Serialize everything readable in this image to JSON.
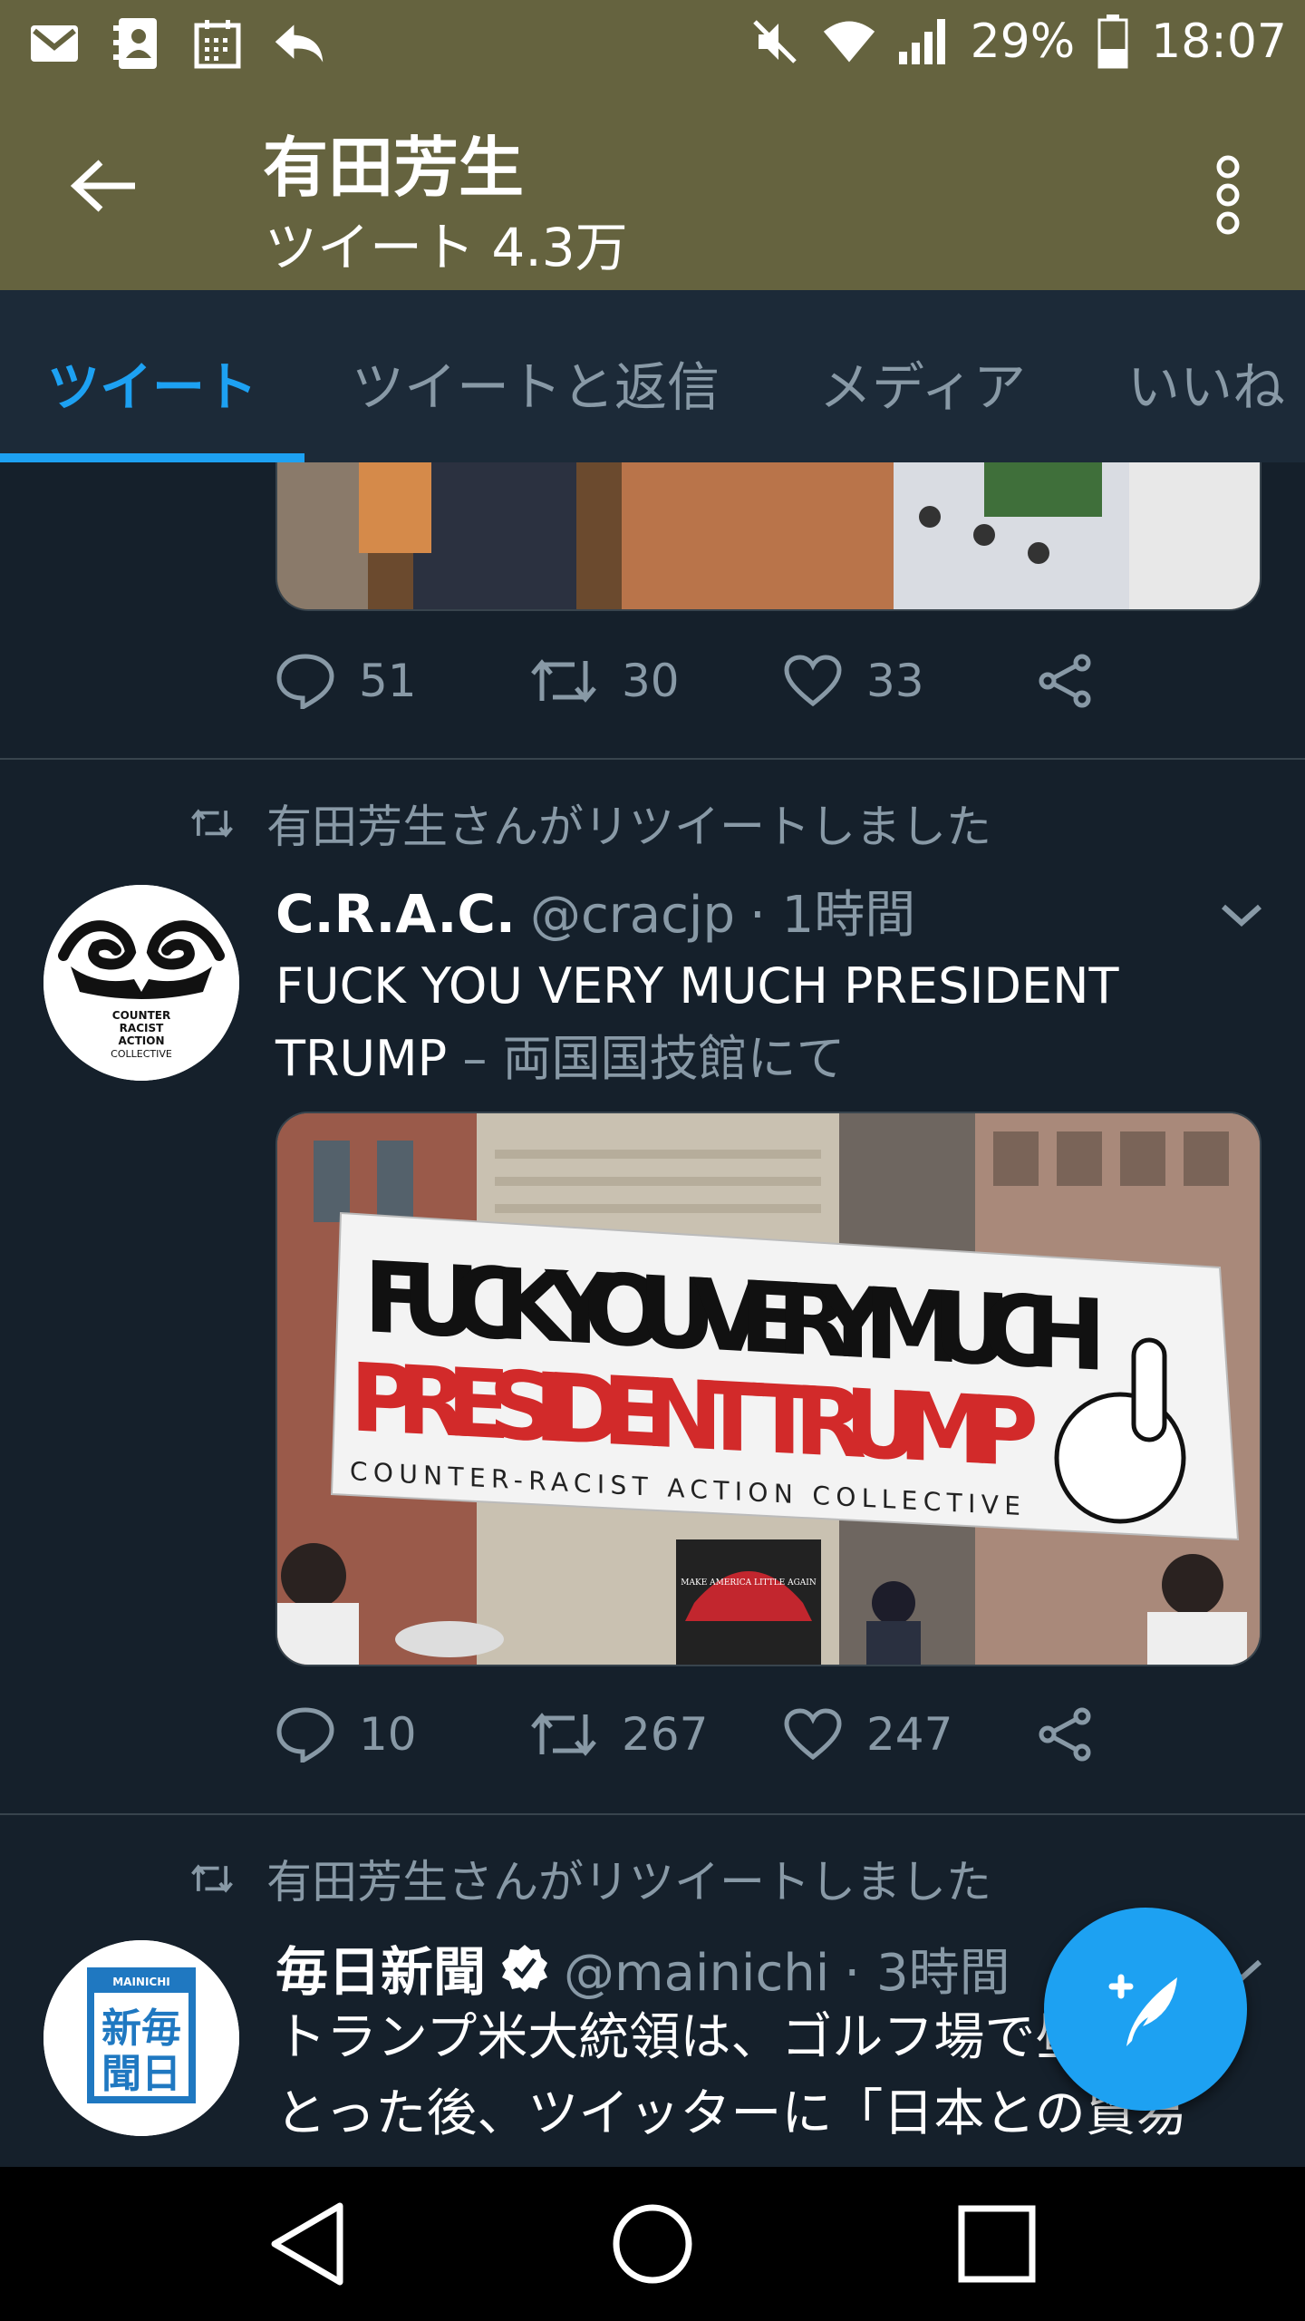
{
  "status_bar": {
    "left_icons": [
      "mail-icon",
      "contacts-icon",
      "calendar-icon",
      "reply-icon"
    ],
    "battery_percent": "29%",
    "time": "18:07",
    "right_icons": [
      "mute-icon",
      "wifi-icon",
      "signal-icon",
      "battery-icon"
    ]
  },
  "header": {
    "title": "有田芳生",
    "subtitle": "ツイート 4.3万",
    "background": "#65633f"
  },
  "tabs": [
    {
      "label": "ツイート",
      "active": true
    },
    {
      "label": "ツイートと返信",
      "active": false
    },
    {
      "label": "メディア",
      "active": false
    },
    {
      "label": "いいね",
      "active": false
    }
  ],
  "tweets": [
    {
      "partial": true,
      "actions": {
        "reply": "51",
        "retweet": "30",
        "like": "33"
      }
    },
    {
      "retweet_label": "有田芳生さんがリツイートしました",
      "name": "C.R.A.C.",
      "handle": "@cracjp",
      "time": "· 1時間",
      "text_line1": "FUCK YOU VERY MUCH PRESIDENT",
      "text_line2": "TRUMP",
      "location": "– 両国国技館にて",
      "avatar_logo_text": "COUNTER RACIST ACTION COLLECTIVE",
      "media": {
        "banner_line1": "FUCK YOU VERY MUCH",
        "banner_line2": "PRESIDENT TRUMP",
        "banner_line3": "COUNTER-RACIST ACTION COLLECTIVE",
        "hat_text": "MAKE AMERICA LITTLE AGAIN"
      },
      "actions": {
        "reply": "10",
        "retweet": "267",
        "like": "247"
      }
    },
    {
      "retweet_label": "有田芳生さんがリツイートしました",
      "name": "毎日新聞",
      "verified": true,
      "handle": "@mainichi",
      "time": "· 3時間",
      "text_line1": "トランプ米大統領は、ゴルフ場で昼食を",
      "text_line2": "とった後、ツイッターに「日本との貿易",
      "avatar_logo_text": "MAINICHI 毎日新聞"
    }
  ],
  "colors": {
    "accent": "#1da1f2",
    "background": "#15202b",
    "muted": "#8899a6"
  }
}
